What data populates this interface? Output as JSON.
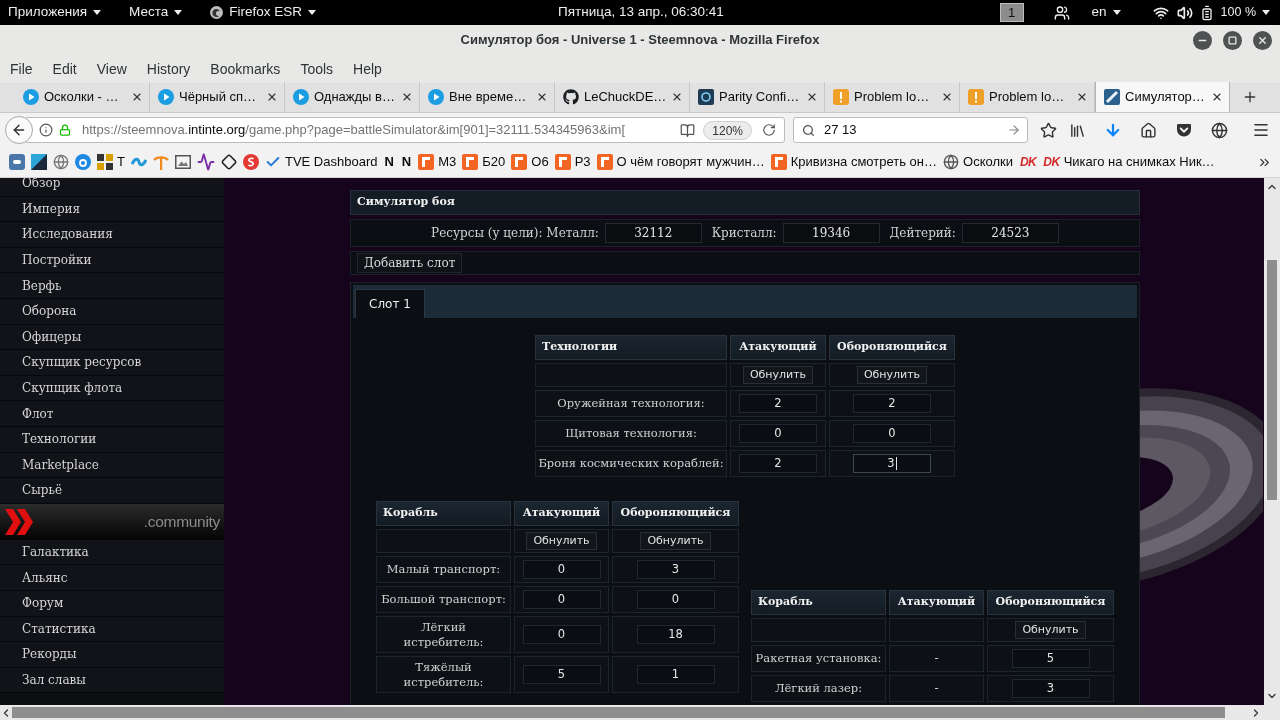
{
  "system_bar": {
    "menus": [
      "Приложения",
      "Места",
      "Firefox ESR"
    ],
    "clock": "Пятница, 13 апр., 06:30:41",
    "workspace": "1",
    "keyboard_layout": "en",
    "battery": "100 %"
  },
  "window": {
    "title": "Симулятор боя - Universe 1 - Steemnova - Mozilla Firefox"
  },
  "menu_bar": [
    "File",
    "Edit",
    "View",
    "History",
    "Bookmarks",
    "Tools",
    "Help"
  ],
  "tabs": [
    {
      "label": "Осколки - …",
      "selected": false
    },
    {
      "label": "Чёрный сп…",
      "selected": false
    },
    {
      "label": "Однажды в…",
      "selected": false
    },
    {
      "label": "Вне време…",
      "selected": false
    },
    {
      "label": "LeChuckDE…",
      "selected": false
    },
    {
      "label": "Parity Confi…",
      "selected": false
    },
    {
      "label": "Problem lo…",
      "selected": false
    },
    {
      "label": "Problem lo…",
      "selected": false
    },
    {
      "label": "Симулятор…",
      "selected": true
    }
  ],
  "nav_bar": {
    "url": "https://steemnova.**intinte.org**/game.php?page=battleSimulator&im[901]=32111.534345963&im[",
    "zoom": "120%",
    "search": "27 13"
  },
  "bookmarks": [
    {
      "kind": "icon"
    },
    {
      "kind": "icon"
    },
    {
      "kind": "icon"
    },
    {
      "kind": "icon"
    },
    {
      "kind": "icon",
      "label": "T"
    },
    {
      "kind": "icon"
    },
    {
      "kind": "icon"
    },
    {
      "kind": "icon"
    },
    {
      "kind": "icon"
    },
    {
      "kind": "icon"
    },
    {
      "kind": "icon"
    },
    {
      "kind": "icon",
      "label": "TVE Dashboard"
    },
    {
      "kind": "letter",
      "badge": "N",
      "color": "#0c0c0d"
    },
    {
      "kind": "letter",
      "badge": "N",
      "color": "#0c0c0d"
    },
    {
      "kind": "icon",
      "label": "М3"
    },
    {
      "kind": "icon",
      "label": "Б20"
    },
    {
      "kind": "icon",
      "label": "О6"
    },
    {
      "kind": "icon",
      "label": "Р3"
    },
    {
      "kind": "icon",
      "label": "О чём говорят мужчин…"
    },
    {
      "kind": "icon",
      "label": "Кривизна смотреть он…"
    },
    {
      "kind": "icon",
      "label": "Осколки"
    },
    {
      "kind": "badge",
      "badge": "DK",
      "color": "#d42a2a"
    },
    {
      "kind": "badge",
      "badge": "DK",
      "color": "#d42a2a",
      "label": "Чикаго на снимках Ник…"
    }
  ],
  "sidebar": {
    "items": [
      "Обзор",
      "Империя",
      "Исследования",
      "Постройки",
      "Верфь",
      "Оборона",
      "Офицеры",
      "Скупщик ресурсов",
      "Скупщик флота",
      "Флот",
      "Технологии",
      "Marketplace",
      "Сырьё"
    ],
    "banner": ".community",
    "community_items": [
      "Галактика",
      "Альянс",
      "Форум",
      "Статистика",
      "Рекорды",
      "Зал славы"
    ]
  },
  "simulator": {
    "title": "Симулятор боя",
    "resources": [
      {
        "label": "Ресурсы (у цели): Металл:",
        "value": "32112"
      },
      {
        "label": "Кристалл:",
        "value": "19346"
      },
      {
        "label": "Дейтерий:",
        "value": "24523"
      }
    ],
    "add_slot": "Добавить слот",
    "slots": [
      {
        "label": "Слот 1",
        "selected": true
      }
    ],
    "tech_table": {
      "columns": [
        "Технологии",
        "Атакующий",
        "Обороняющийся"
      ],
      "reset": {
        "attacker": "Обнулить",
        "defender": "Обнулить"
      },
      "rows": [
        {
          "label": "Оружейная технология:",
          "attacker": {
            "kind": "input",
            "value": "2",
            "focused": false
          },
          "defender": {
            "kind": "input",
            "value": "2",
            "focused": false
          }
        },
        {
          "label": "Щитовая технология:",
          "attacker": {
            "kind": "input",
            "value": "0",
            "focused": false
          },
          "defender": {
            "kind": "input",
            "value": "0",
            "focused": false
          }
        },
        {
          "label": "Броня космических кораблей:",
          "attacker": {
            "kind": "input",
            "value": "2",
            "focused": false
          },
          "defender": {
            "kind": "input",
            "value": "3",
            "focused": true
          }
        }
      ]
    },
    "ship_table": {
      "columns": [
        "Корабль",
        "Атакующий",
        "Обороняющийся"
      ],
      "reset": {
        "attacker": "Обнулить",
        "defender": "Обнулить"
      },
      "rows": [
        {
          "label": "Малый транспорт:",
          "attacker": {
            "kind": "input",
            "value": "0"
          },
          "defender": {
            "kind": "input",
            "value": "3"
          }
        },
        {
          "label": "Большой транспорт:",
          "attacker": {
            "kind": "input",
            "value": "0"
          },
          "defender": {
            "kind": "input",
            "value": "0"
          }
        },
        {
          "label": "Лёгкий истребитель:",
          "attacker": {
            "kind": "input",
            "value": "0"
          },
          "defender": {
            "kind": "input",
            "value": "18"
          }
        },
        {
          "label": "Тяжёлый истребитель:",
          "attacker": {
            "kind": "input",
            "value": "5"
          },
          "defender": {
            "kind": "input",
            "value": "1"
          }
        }
      ]
    },
    "defense_table": {
      "columns": [
        "Корабль",
        "Атакующий",
        "Обороняющийся"
      ],
      "reset": {
        "defender": "Обнулить"
      },
      "rows": [
        {
          "label": "Ракетная установка:",
          "attacker": {
            "kind": "text",
            "value": "-"
          },
          "defender": {
            "kind": "input",
            "value": "5"
          }
        },
        {
          "label": "Лёгкий лазер:",
          "attacker": {
            "kind": "text",
            "value": "-"
          },
          "defender": {
            "kind": "input",
            "value": "3"
          }
        }
      ]
    }
  }
}
